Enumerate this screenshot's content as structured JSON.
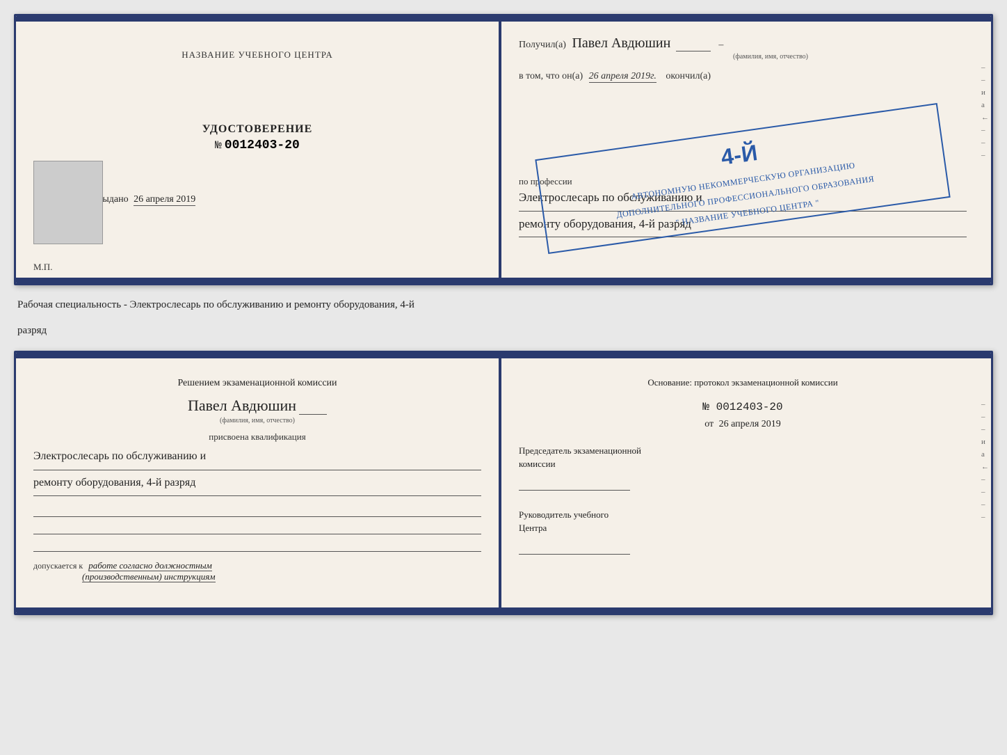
{
  "top_booklet": {
    "left": {
      "org_name_placeholder": "НАЗВАНИЕ УЧЕБНОГО ЦЕНТРА",
      "cert_type": "УДОСТОВЕРЕНИЕ",
      "cert_no_prefix": "№",
      "cert_number": "0012403-20",
      "issued_label": "Выдано",
      "issued_date": "26 апреля 2019",
      "mp_label": "М.П."
    },
    "right": {
      "received_label": "Получил(а)",
      "recipient_name": "Павел Авдюшин",
      "fio_caption": "(фамилия, имя, отчество)",
      "in_that_label": "в том, что он(а)",
      "completion_date": "26 апреля 2019г.",
      "completed_label": "окончил(а)",
      "stamp": {
        "grade": "4-й",
        "line1": "АВТОНОМНУЮ НЕКОММЕРЧЕСКУЮ ОРГАНИЗАЦИЮ",
        "line2": "ДОПОЛНИТЕЛЬНОГО ПРОФЕССИОНАЛЬНОГО ОБРАЗОВАНИЯ",
        "line3": "\"  НАЗВАНИЕ УЧЕБНОГО ЦЕНТРА  \""
      },
      "profession_label": "по профессии",
      "profession_line1": "Электрослесарь по обслуживанию и",
      "profession_line2": "ремонту оборудования, 4-й разряд"
    }
  },
  "description": {
    "text": "Рабочая специальность - Электрослесарь по обслуживанию и ремонту оборудования, 4-й",
    "text2": "разряд"
  },
  "bottom_booklet": {
    "left": {
      "decision_line1": "Решением экзаменационной  комиссии",
      "person_name": "Павел Авдюшин",
      "fio_caption": "(фамилия, имя, отчество)",
      "assigned_label": "присвоена квалификация",
      "qual_line1": "Электрослесарь по обслуживанию и",
      "qual_line2": "ремонту оборудования, 4-й разряд",
      "allowed_label": "допускается к",
      "allowed_text": "работе согласно должностным",
      "allowed_text2": "(производственным) инструкциям"
    },
    "right": {
      "basis_label": "Основание: протокол экзаменационной  комиссии",
      "number_prefix": "№",
      "basis_number": "0012403-20",
      "date_prefix": "от",
      "basis_date": "26 апреля 2019",
      "chairman_label": "Председатель экзаменационной",
      "chairman_label2": "комиссии",
      "head_label": "Руководитель учебного",
      "head_label2": "Центра"
    }
  },
  "right_chars": [
    "–",
    "–",
    "и",
    "а",
    "←",
    "–",
    "–",
    "–"
  ],
  "right_chars_bottom": [
    "–",
    "–",
    "–",
    "и",
    "а",
    "←",
    "–",
    "–",
    "–",
    "–"
  ]
}
